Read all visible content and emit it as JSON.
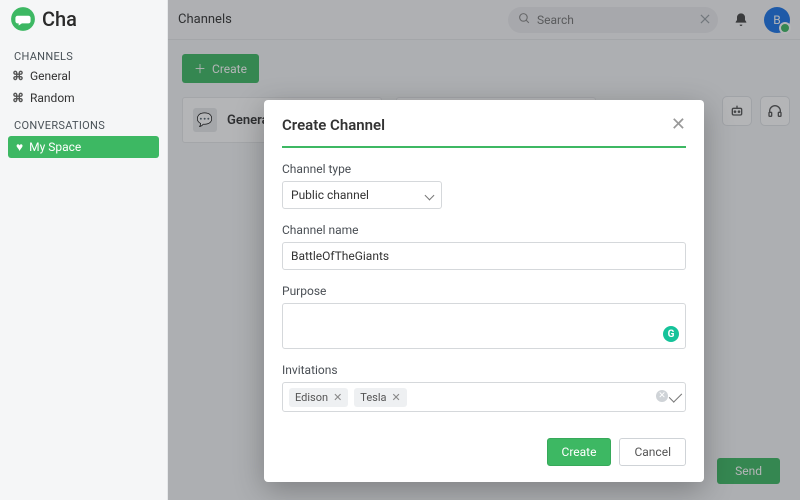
{
  "brand": {
    "name": "Cha"
  },
  "topbar": {
    "title": "Channels",
    "search_placeholder": "Search",
    "avatar_initial": "B"
  },
  "sidebar": {
    "channels_label": "CHANNELS",
    "conversations_label": "CONVERSATIONS",
    "items": [
      {
        "label": "General"
      },
      {
        "label": "Random"
      }
    ],
    "conversation": {
      "label": "My Space"
    }
  },
  "content": {
    "create_button": "Create",
    "cards": [
      {
        "label": "General"
      },
      {
        "label": ""
      }
    ],
    "send_button": "Send"
  },
  "modal": {
    "title": "Create Channel",
    "type_label": "Channel type",
    "type_value": "Public channel",
    "name_label": "Channel name",
    "name_value": "BattleOfTheGiants",
    "purpose_label": "Purpose",
    "invitations_label": "Invitations",
    "invite_chips": [
      "Edison",
      "Tesla"
    ],
    "create_btn": "Create",
    "cancel_btn": "Cancel"
  }
}
